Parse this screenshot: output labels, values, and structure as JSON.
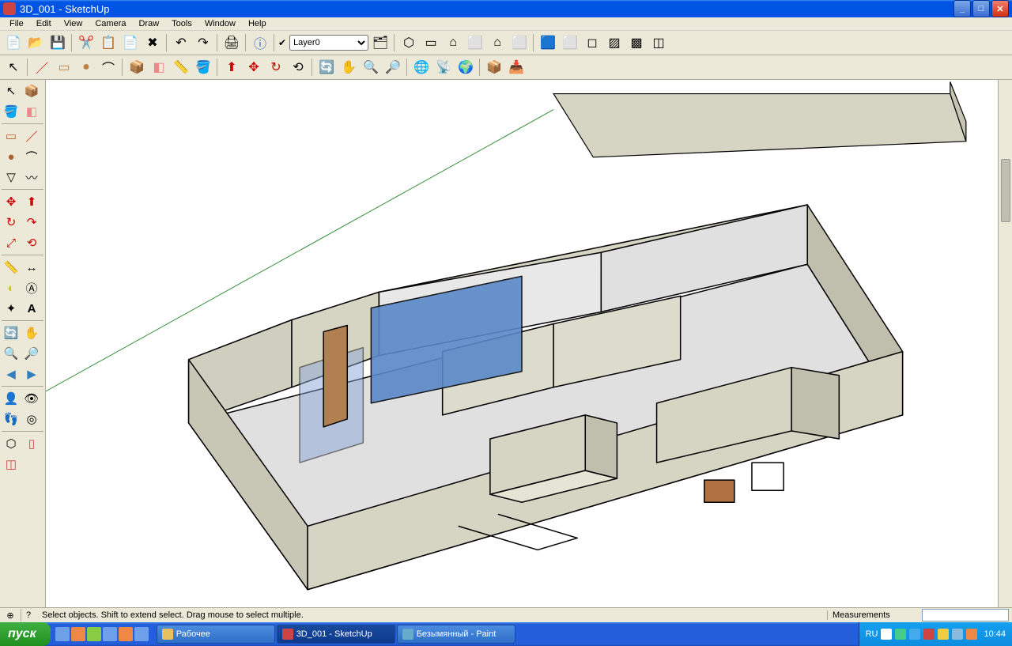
{
  "window": {
    "title": "3D_001 - SketchUp"
  },
  "menu": {
    "file": "File",
    "edit": "Edit",
    "view": "View",
    "camera": "Camera",
    "draw": "Draw",
    "tools": "Tools",
    "window": "Window",
    "help": "Help"
  },
  "layer": {
    "current": "Layer0"
  },
  "status": {
    "hint": "Select objects. Shift to extend select. Drag mouse to select multiple.",
    "measurements_label": "Measurements"
  },
  "taskbar": {
    "start": "пуск",
    "items": [
      {
        "label": "Рабочее",
        "active": false
      },
      {
        "label": "3D_001 - SketchUp",
        "active": true
      },
      {
        "label": "Безымянный - Paint",
        "active": false
      }
    ],
    "lang": "RU",
    "clock": "10:44"
  }
}
